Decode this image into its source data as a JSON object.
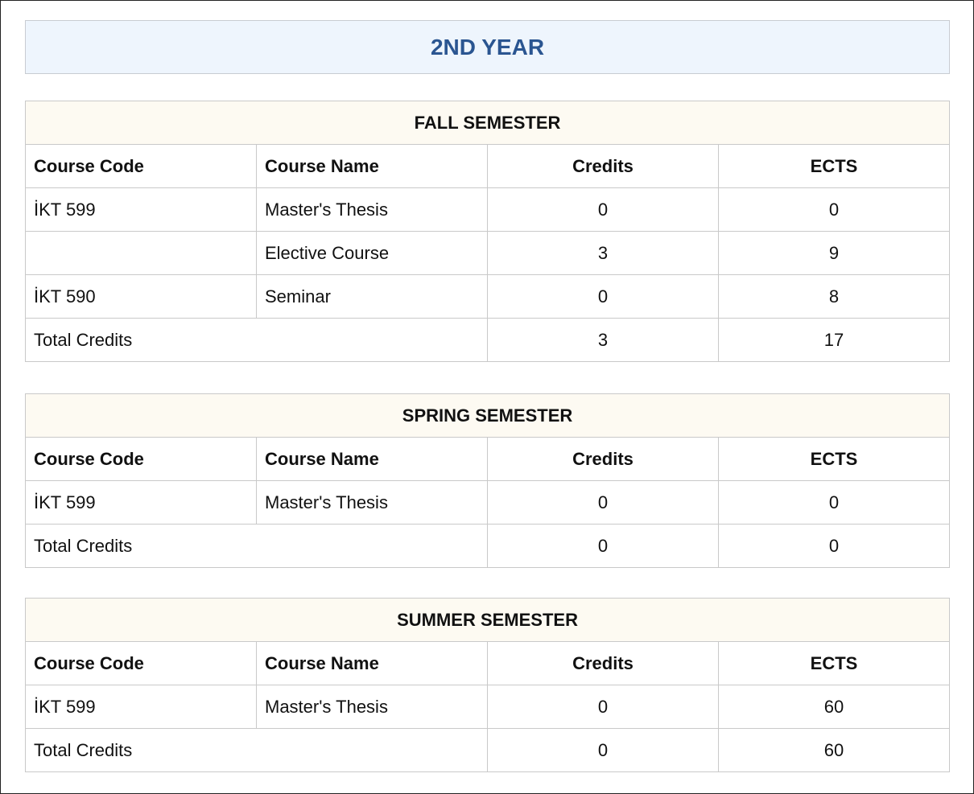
{
  "year_title": "2ND YEAR",
  "headers": {
    "code": "Course Code",
    "name": "Course Name",
    "credits": "Credits",
    "ects": "ECTS"
  },
  "semesters": [
    {
      "title": "FALL SEMESTER",
      "rows": [
        {
          "code": "İKT 599",
          "name": "Master's Thesis",
          "credits": "0",
          "ects": "0"
        },
        {
          "code": "",
          "name": "Elective Course",
          "credits": "3",
          "ects": "9"
        },
        {
          "code": "İKT 590",
          "name": "Seminar",
          "credits": "0",
          "ects": "8"
        }
      ],
      "total": {
        "label": "Total Credits",
        "credits": "3",
        "ects": "17"
      }
    },
    {
      "title": "SPRING SEMESTER",
      "rows": [
        {
          "code": "İKT 599",
          "name": "Master's Thesis",
          "credits": "0",
          "ects": "0"
        }
      ],
      "total": {
        "label": "Total Credits",
        "credits": "0",
        "ects": "0"
      }
    },
    {
      "title": "SUMMER SEMESTER",
      "rows": [
        {
          "code": "İKT 599",
          "name": "Master's Thesis",
          "credits": "0",
          "ects": "60"
        }
      ],
      "total": {
        "label": "Total Credits",
        "credits": "0",
        "ects": "60"
      }
    }
  ]
}
